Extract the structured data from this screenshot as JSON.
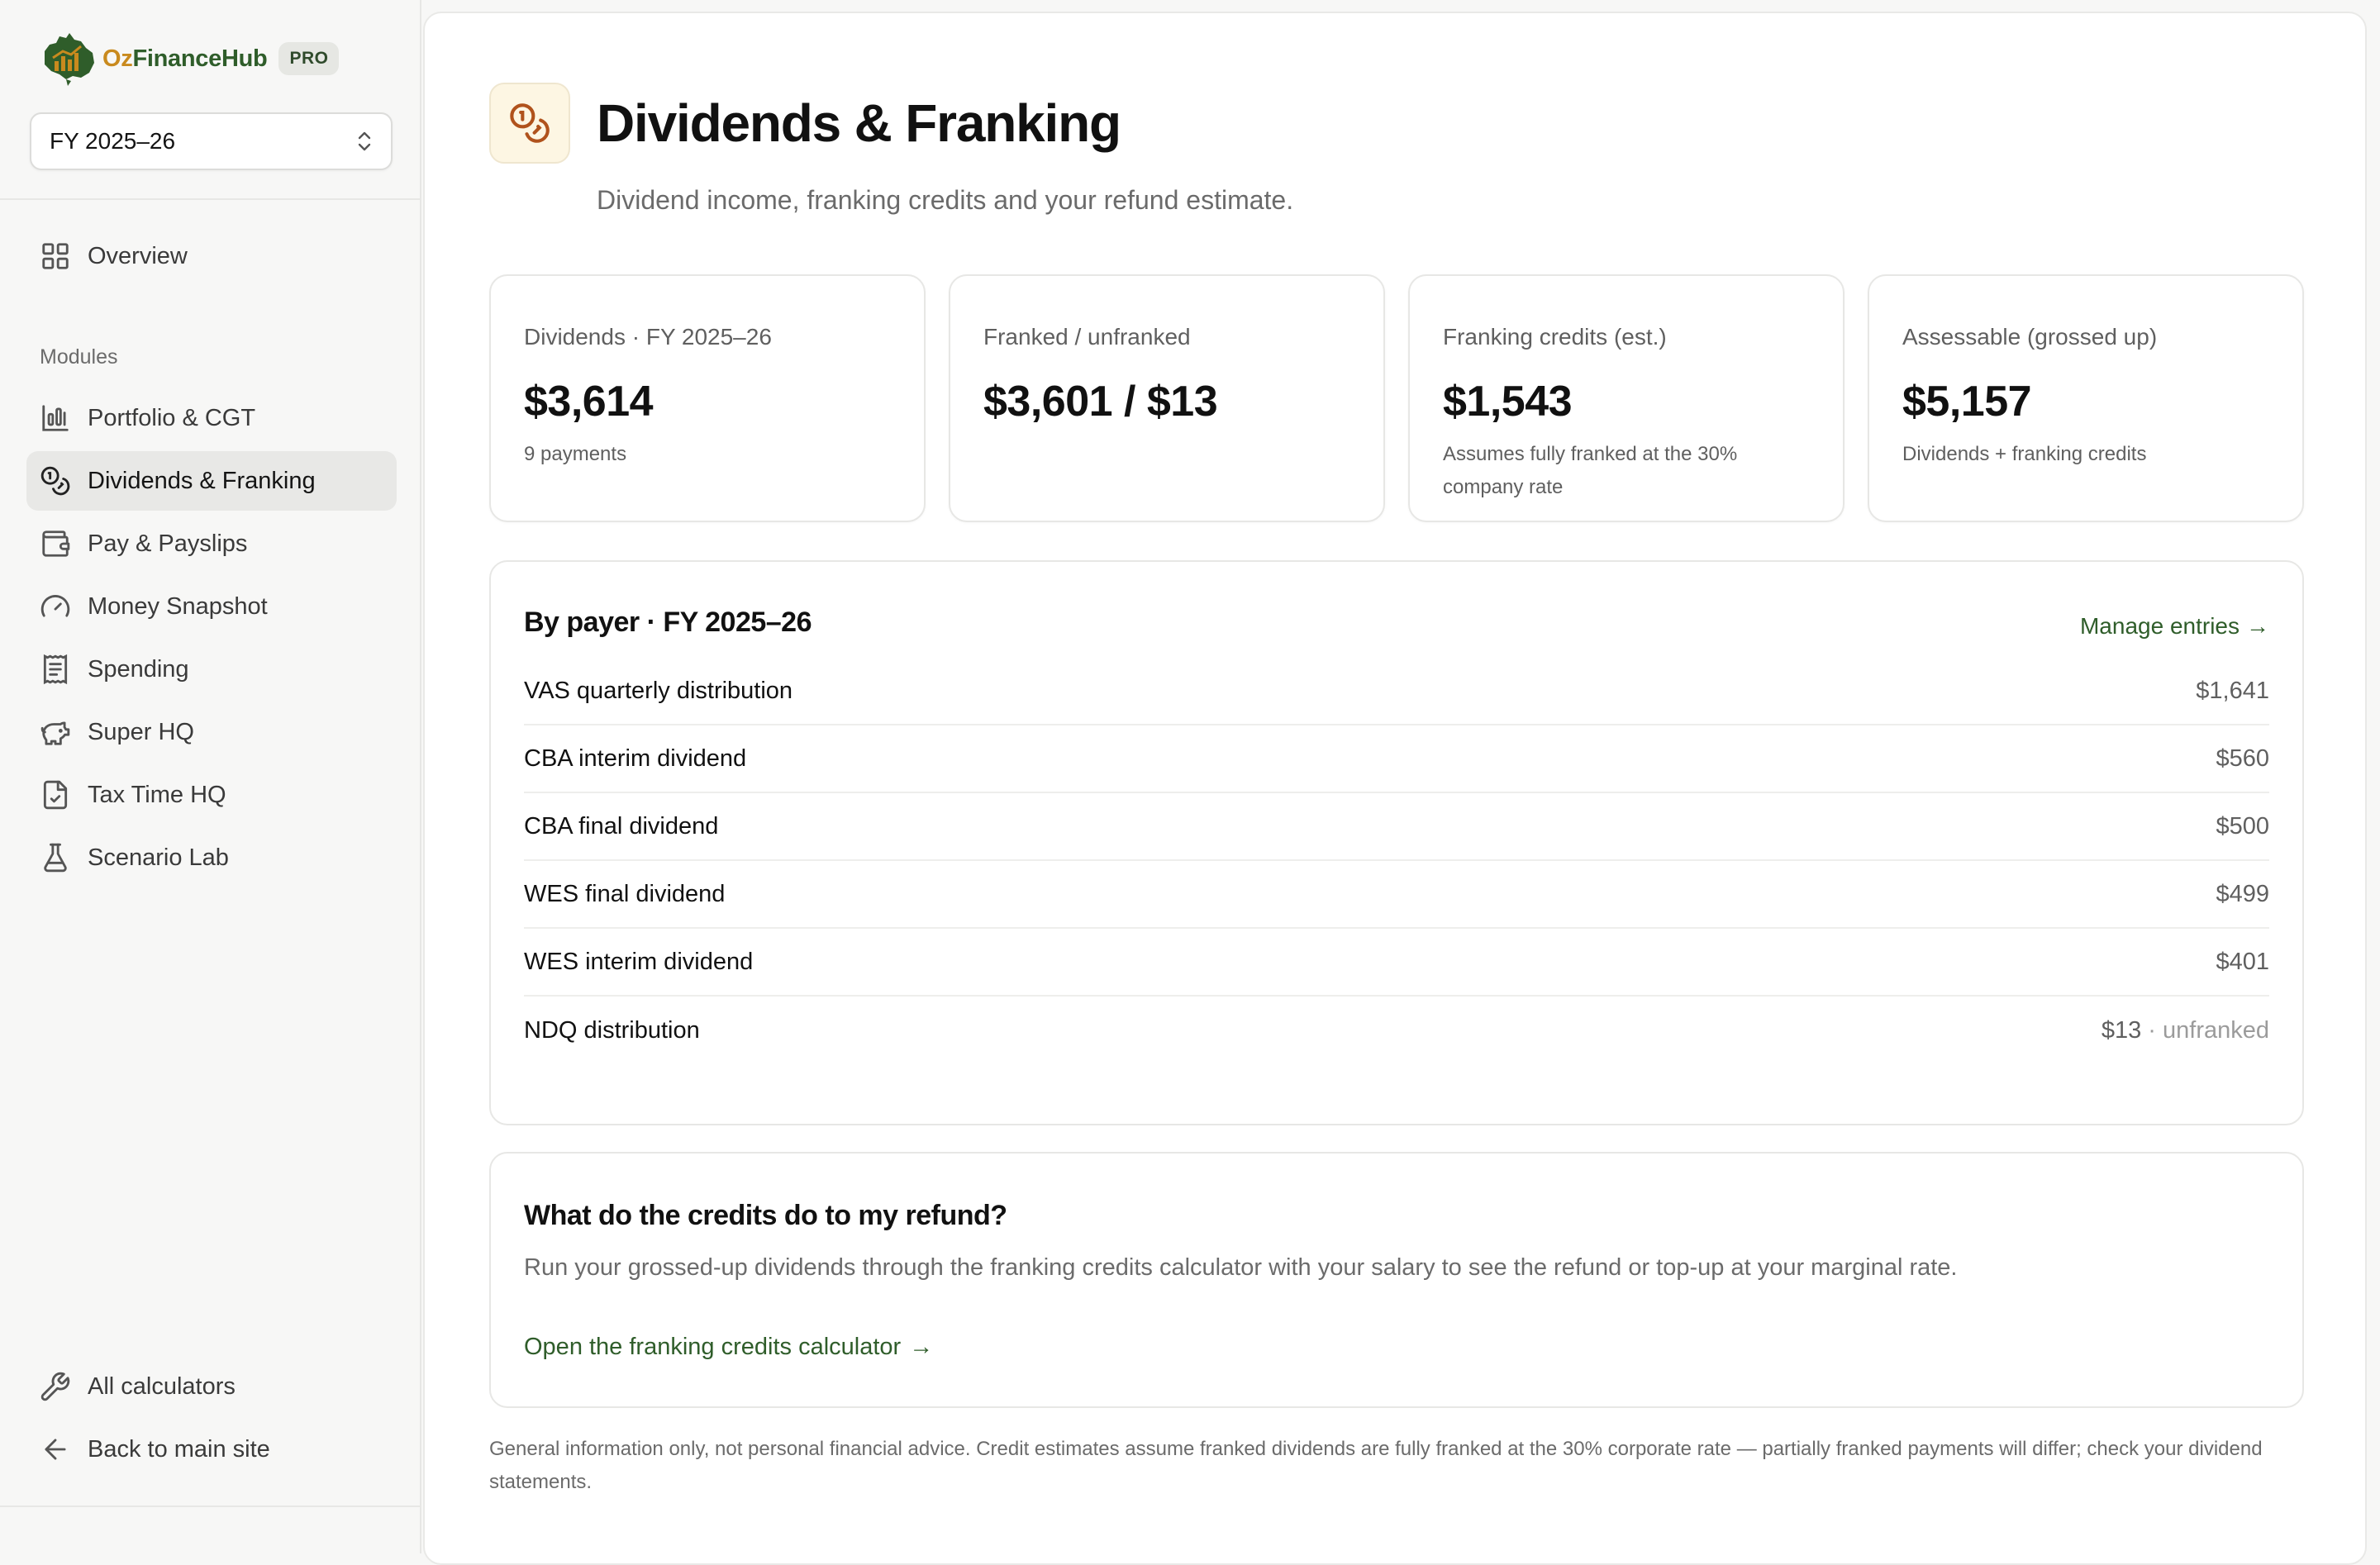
{
  "brand": {
    "name_part1": "Oz",
    "name_part2": "FinanceHub",
    "badge": "PRO"
  },
  "fy_selector": {
    "value": "FY 2025–26"
  },
  "sidebar": {
    "overview": "Overview",
    "section_label": "Modules",
    "modules": [
      {
        "label": "Portfolio & CGT",
        "icon": "bar-chart-icon"
      },
      {
        "label": "Dividends & Franking",
        "icon": "coins-icon",
        "active": true
      },
      {
        "label": "Pay & Payslips",
        "icon": "wallet-icon"
      },
      {
        "label": "Money Snapshot",
        "icon": "gauge-icon"
      },
      {
        "label": "Spending",
        "icon": "receipt-icon"
      },
      {
        "label": "Super HQ",
        "icon": "piggy-bank-icon"
      },
      {
        "label": "Tax Time HQ",
        "icon": "file-check-icon"
      },
      {
        "label": "Scenario Lab",
        "icon": "flask-icon"
      }
    ],
    "footer": [
      {
        "label": "All calculators",
        "icon": "wrench-icon"
      },
      {
        "label": "Back to main site",
        "icon": "arrow-left-icon"
      }
    ]
  },
  "page": {
    "title": "Dividends & Franking",
    "subtitle": "Dividend income, franking credits and your refund estimate."
  },
  "stats": [
    {
      "label": "Dividends · FY 2025–26",
      "value": "$3,614",
      "note": "9 payments"
    },
    {
      "label": "Franked / unfranked",
      "value": "$3,601 / $13",
      "note": ""
    },
    {
      "label": "Franking credits (est.)",
      "value": "$1,543",
      "note": "Assumes fully franked at the 30% company rate"
    },
    {
      "label": "Assessable (grossed up)",
      "value": "$5,157",
      "note": "Dividends + franking credits"
    }
  ],
  "by_payer": {
    "title": "By payer · FY 2025–26",
    "manage_link": "Manage entries",
    "rows": [
      {
        "name": "VAS quarterly distribution",
        "amount": "$1,641",
        "suffix": ""
      },
      {
        "name": "CBA interim dividend",
        "amount": "$560",
        "suffix": ""
      },
      {
        "name": "CBA final dividend",
        "amount": "$500",
        "suffix": ""
      },
      {
        "name": "WES final dividend",
        "amount": "$499",
        "suffix": ""
      },
      {
        "name": "WES interim dividend",
        "amount": "$401",
        "suffix": ""
      },
      {
        "name": "NDQ distribution",
        "amount": "$13",
        "suffix": "· unfranked"
      }
    ]
  },
  "refund": {
    "title": "What do the credits do to my refund?",
    "text": "Run your grossed-up dividends through the franking credits calculator with your salary to see the refund or top-up at your marginal rate.",
    "link": "Open the franking credits calculator"
  },
  "disclaimer": "General information only, not personal financial advice. Credit estimates assume franked dividends are fully franked at the 30% corporate rate — partially franked payments will differ; check your dividend statements.",
  "colors": {
    "brand_green": "#2f5d2a",
    "brand_gold": "#c98a1e",
    "active_bg": "#e8e8e6"
  }
}
